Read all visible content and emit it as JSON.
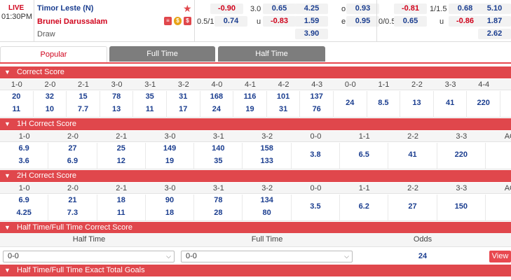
{
  "match": {
    "status": "LIVE",
    "time": "01:30PM",
    "home": "Timor Leste (N)",
    "away": "Brunei Darussalam",
    "draw": "Draw",
    "ft": {
      "r1": {
        "o1": "-0.90",
        "line": "3.0",
        "o2": "0.65",
        "x": "4.25",
        "ou": "o",
        "ouv": "0.93"
      },
      "r2": {
        "line": "0.5/1",
        "o1": "0.74",
        "ou": "u",
        "o2": "-0.83",
        "x": "1.59",
        "eo": "e",
        "eov": "0.95"
      },
      "r3": {
        "x": "3.90"
      }
    },
    "ht": {
      "r1": {
        "o1": "-0.81",
        "line": "1/1.5",
        "o2": "0.68",
        "x": "5.10"
      },
      "r2": {
        "line": "0/0.5",
        "o1": "0.65",
        "ou": "u",
        "o2": "-0.86",
        "x": "1.87"
      },
      "r3": {
        "x": "2.62"
      }
    }
  },
  "tabs": [
    {
      "label": "Popular",
      "active": true
    },
    {
      "label": "Full Time",
      "active": false
    },
    {
      "label": "Half Time",
      "active": false
    }
  ],
  "correct_score": {
    "title": "Correct Score",
    "headers": [
      "1-0",
      "2-0",
      "2-1",
      "3-0",
      "3-1",
      "3-2",
      "4-0",
      "4-1",
      "4-2",
      "4-3",
      "0-0",
      "1-1",
      "2-2",
      "3-3",
      "4-4"
    ],
    "row1": [
      "20",
      "32",
      "15",
      "78",
      "35",
      "31",
      "168",
      "116",
      "101",
      "137"
    ],
    "row2": [
      "11",
      "10",
      "7.7",
      "13",
      "11",
      "17",
      "24",
      "19",
      "31",
      "76"
    ],
    "draws": [
      "24",
      "8.5",
      "13",
      "41",
      "220"
    ]
  },
  "h1_correct_score": {
    "title": "1H Correct Score",
    "headers": [
      "1-0",
      "2-0",
      "2-1",
      "3-0",
      "3-1",
      "3-2",
      "0-0",
      "1-1",
      "2-2",
      "3-3",
      "AO"
    ],
    "row1": [
      "6.9",
      "27",
      "25",
      "149",
      "140",
      "158"
    ],
    "row2": [
      "3.6",
      "6.9",
      "12",
      "19",
      "35",
      "133"
    ],
    "draws": [
      "3.8",
      "6.5",
      "41",
      "220"
    ]
  },
  "h2_correct_score": {
    "title": "2H Correct Score",
    "headers": [
      "1-0",
      "2-0",
      "2-1",
      "3-0",
      "3-1",
      "3-2",
      "0-0",
      "1-1",
      "2-2",
      "3-3",
      "AO"
    ],
    "row1": [
      "6.9",
      "21",
      "18",
      "90",
      "78",
      "134"
    ],
    "row2": [
      "4.25",
      "7.3",
      "11",
      "18",
      "28",
      "80"
    ],
    "draws": [
      "3.5",
      "6.2",
      "27",
      "150"
    ]
  },
  "htft": {
    "title": "Half Time/Full Time Correct Score",
    "half_time_label": "Half Time",
    "full_time_label": "Full Time",
    "odds_label": "Odds",
    "ht_value": "0-0",
    "ft_value": "0-0",
    "odds": "24",
    "view_label": "View"
  },
  "htft_exact": {
    "title": "Half Time/Full Time Exact Total Goals"
  },
  "icons": {
    "collapse": "chevron-down-icon",
    "favorite": "star-icon"
  }
}
